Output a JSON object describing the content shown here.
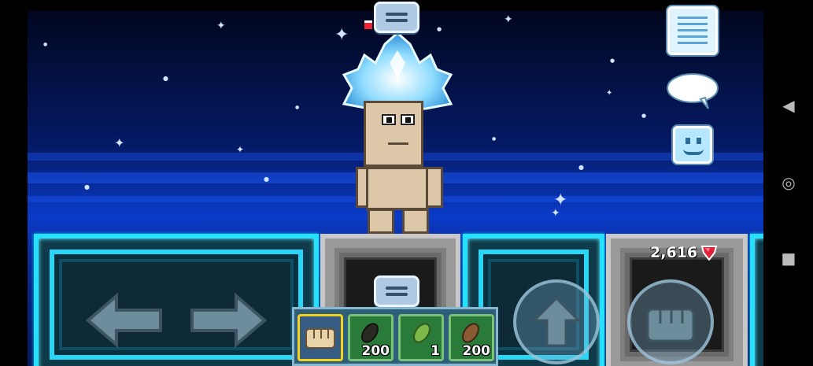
{
  "game": {
    "gems": "2,616",
    "colors": {
      "neon": "#26e0ff",
      "sky": "#0b3bc8",
      "gem": "#e0223a",
      "slot_selected": "#f4d11a"
    }
  },
  "inventory": {
    "slots": [
      {
        "name": "fist",
        "count": ""
      },
      {
        "name": "dark-seed",
        "count": "200"
      },
      {
        "name": "green-seed",
        "count": "1"
      },
      {
        "name": "brown-seed",
        "count": "200"
      }
    ]
  },
  "icons": {
    "menu": "menu-tab-icon",
    "list": "list-icon",
    "chat": "chat-bubble-icon",
    "emote": "smiley-icon",
    "jump": "up-arrow-icon",
    "punch": "fist-icon",
    "back": "back-triangle-icon",
    "home": "home-circle-icon",
    "recents": "square-icon"
  }
}
